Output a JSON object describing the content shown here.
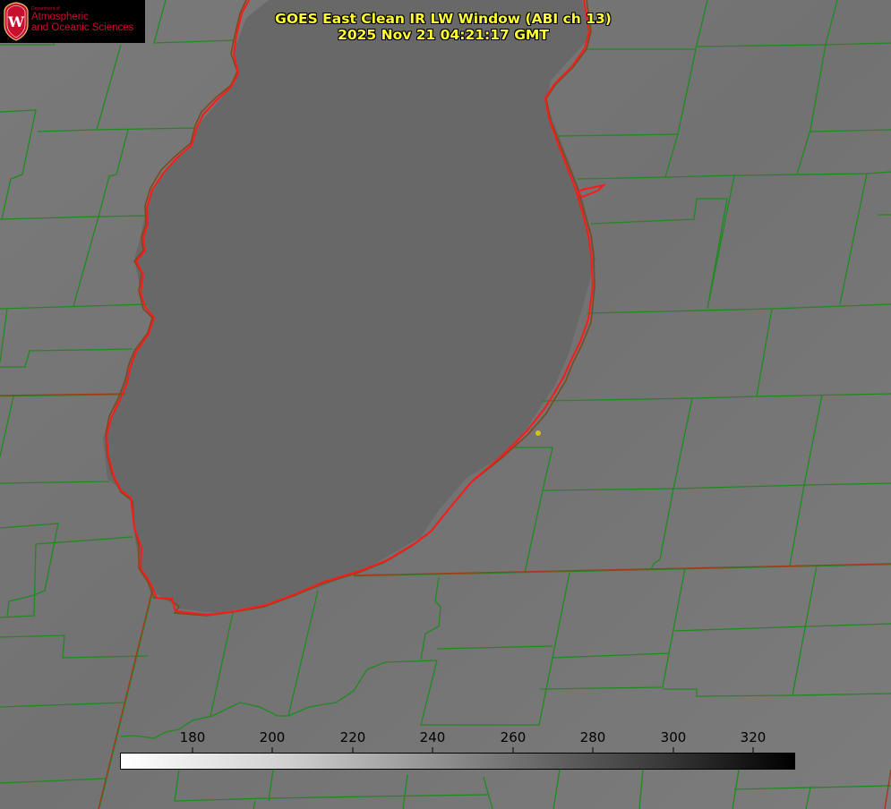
{
  "logo": {
    "department_line": "Department of",
    "line1": "Atmospheric",
    "line2": "and Oceanic Sciences",
    "shield_letter": "W"
  },
  "title": {
    "line1": "GOES East Clean IR LW Window (ABI ch 13)",
    "line2": "2025 Nov 21 04:21:17 GMT"
  },
  "colorbar": {
    "ticks": [
      "180",
      "200",
      "220",
      "240",
      "260",
      "280",
      "300",
      "320"
    ],
    "min_value": 163,
    "max_value": 330
  },
  "colors": {
    "county_lines": "#1f8a1f",
    "state_lines": "#a23a1a",
    "lake_outline": "#ff1a1a",
    "title_text": "#ffff33",
    "marker": "#d4c21a",
    "logo_red": "#c8102e"
  },
  "icons": {
    "logo": "uw-shield-icon",
    "station": "location-dot-icon"
  }
}
